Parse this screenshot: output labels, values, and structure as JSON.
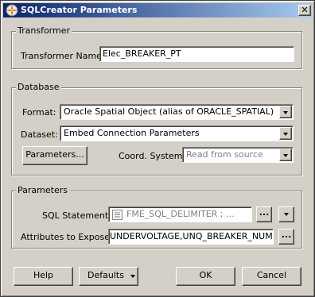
{
  "window": {
    "title": "SQLCreator Parameters",
    "close_glyph": "✕"
  },
  "transformer": {
    "group_title": "Transformer",
    "name_label": "Transformer Name:",
    "name_value": "Elec_BREAKER_PT"
  },
  "database": {
    "group_title": "Database",
    "format_label": "Format:",
    "format_value": "Oracle Spatial Object (alias of ORACLE_SPATIAL)",
    "dataset_label": "Dataset:",
    "dataset_value": "Embed Connection Parameters",
    "parameters_button": "Parameters...",
    "coord_label": "Coord. System:",
    "coord_value": "Read from source"
  },
  "parameters": {
    "group_title": "Parameters",
    "sql_label": "SQL Statement:",
    "sql_value": "FME_SQL_DELIMITER ; ...",
    "ellipsis": "...",
    "attributes_label": "Attributes to Expose:",
    "attributes_value": "UNDERVOLTAGE,UNQ_BREAKER_NUMBER"
  },
  "footer": {
    "help": "Help",
    "defaults": "Defaults",
    "ok": "OK",
    "cancel": "Cancel"
  },
  "colors": {
    "titlebar_start": "#0a246a",
    "titlebar_end": "#a6caf0",
    "face": "#d4d0c8"
  }
}
